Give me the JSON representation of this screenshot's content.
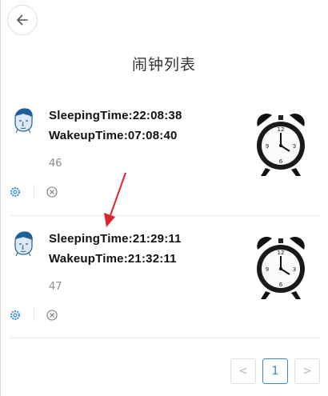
{
  "header": {
    "title": "闹钟列表",
    "back_icon": "arrow-left-icon"
  },
  "alarms": [
    {
      "sleep": "SleepingTime:22:08:38",
      "wake": "WakeupTime:07:08:40",
      "id": "46"
    },
    {
      "sleep": "SleepingTime:21:29:11",
      "wake": "WakeupTime:21:32:11",
      "id": "47"
    }
  ],
  "pagination": {
    "prev": "<",
    "current": "1",
    "next": ">"
  },
  "colors": {
    "accent": "#2f89d6",
    "annotation": "#d9262b"
  },
  "icons": [
    "avatar-icon",
    "alarm-clock-icon",
    "gear-icon",
    "close-circle-icon"
  ]
}
